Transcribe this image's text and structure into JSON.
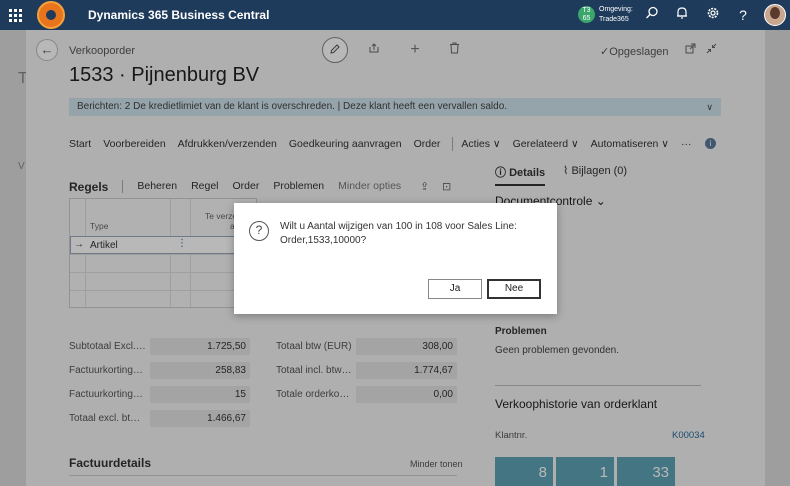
{
  "app": {
    "title": "Dynamics 365 Business Central",
    "env_badge": "T3 65",
    "env_label": "Omgeving:",
    "env_name": "Trade365"
  },
  "background": {
    "letter_t": "T",
    "letter_v": "V"
  },
  "page": {
    "kind": "Verkooporder",
    "title": "1533 · Pijnenburg BV",
    "saved": "Opgeslagen",
    "notification": "Berichten: 2    De kredietlimiet van de klant is overschreden. |  Deze klant heeft een vervallen saldo."
  },
  "menu": [
    "Start",
    "Voorbereiden",
    "Afdrukken/verzenden",
    "Goedkeuring aanvragen",
    "Order",
    "Acties ∨",
    "Gerelateerd ∨",
    "Automatiseren ∨",
    "···"
  ],
  "lines": {
    "title": "Regels",
    "actions": [
      "Beheren",
      "Regel",
      "Order",
      "Problemen",
      "Minder opties"
    ],
    "col_type": "Type",
    "col_te": "Te verzen...",
    "col_te2": "a...",
    "row_type": "Artikel"
  },
  "totals": {
    "left": [
      {
        "label": "Subtotaal Excl.…",
        "value": "1.725,50"
      },
      {
        "label": "Factuurkorting…",
        "value": "258,83"
      },
      {
        "label": "Factuurkorting…",
        "value": "15"
      },
      {
        "label": "Totaal excl. bt…",
        "value": "1.466,67"
      }
    ],
    "right": [
      {
        "label": "Totaal btw (EUR)",
        "value": "308,00"
      },
      {
        "label": "Totaal incl. btw…",
        "value": "1.774,67"
      },
      {
        "label": "Totale orderko…",
        "value": "0,00"
      }
    ]
  },
  "side": {
    "tab_details": "Details",
    "tab_attachments": "Bijlagen (0)",
    "doc_control": "Documentcontrole",
    "problems_title": "Problemen",
    "problems_text": "Geen problemen gevonden.",
    "history_title": "Verkoophistorie van orderklant",
    "customer_label": "Klantnr.",
    "customer_value": "K00034",
    "tiles": [
      "8",
      "1",
      "33"
    ]
  },
  "invoice": {
    "title": "Factuurdetails",
    "less": "Minder tonen"
  },
  "dialog": {
    "message": "Wilt u Aantal wijzigen van 100 in 108 voor Sales Line: Order,1533,10000?",
    "yes": "Ja",
    "no": "Nee"
  },
  "icons": [
    "waffle-icon",
    "search-icon",
    "bell-icon",
    "gear-icon",
    "help-icon",
    "back-icon",
    "edit-icon",
    "share-icon",
    "add-icon",
    "delete-icon",
    "open-new-icon",
    "collapse-icon",
    "question-icon",
    "paperclip-icon",
    "info-icon"
  ]
}
